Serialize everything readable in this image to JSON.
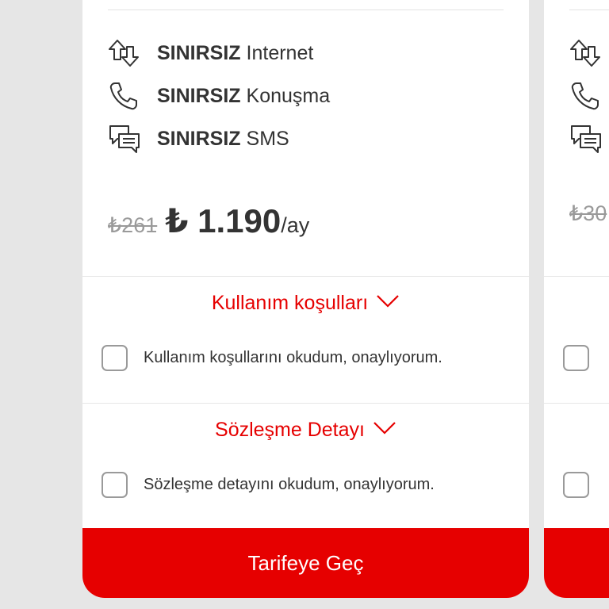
{
  "main_card": {
    "features": [
      {
        "bold": "SINIRSIZ",
        "text": " Internet",
        "icon": "data-transfer-icon"
      },
      {
        "bold": "SINIRSIZ",
        "text": " Konuşma",
        "icon": "phone-icon"
      },
      {
        "bold": "SINIRSIZ",
        "text": " SMS",
        "icon": "chat-icon"
      }
    ],
    "price": {
      "old": "₺261",
      "new": "₺ 1.190",
      "per": "/ay"
    },
    "terms": {
      "title": "Kullanım koşulları",
      "checkbox_label": "Kullanım koşullarını okudum, onaylıyorum."
    },
    "contract": {
      "title": "Sözleşme Detayı",
      "checkbox_label": "Sözleşme detayını okudum, onaylıyorum."
    },
    "cta_label": "Tarifeye Geç"
  },
  "next_card": {
    "old_price_partial": "₺30"
  },
  "colors": {
    "accent": "#e60000",
    "text": "#333333",
    "muted": "#9a9a9a",
    "background": "#e6e6e6"
  }
}
